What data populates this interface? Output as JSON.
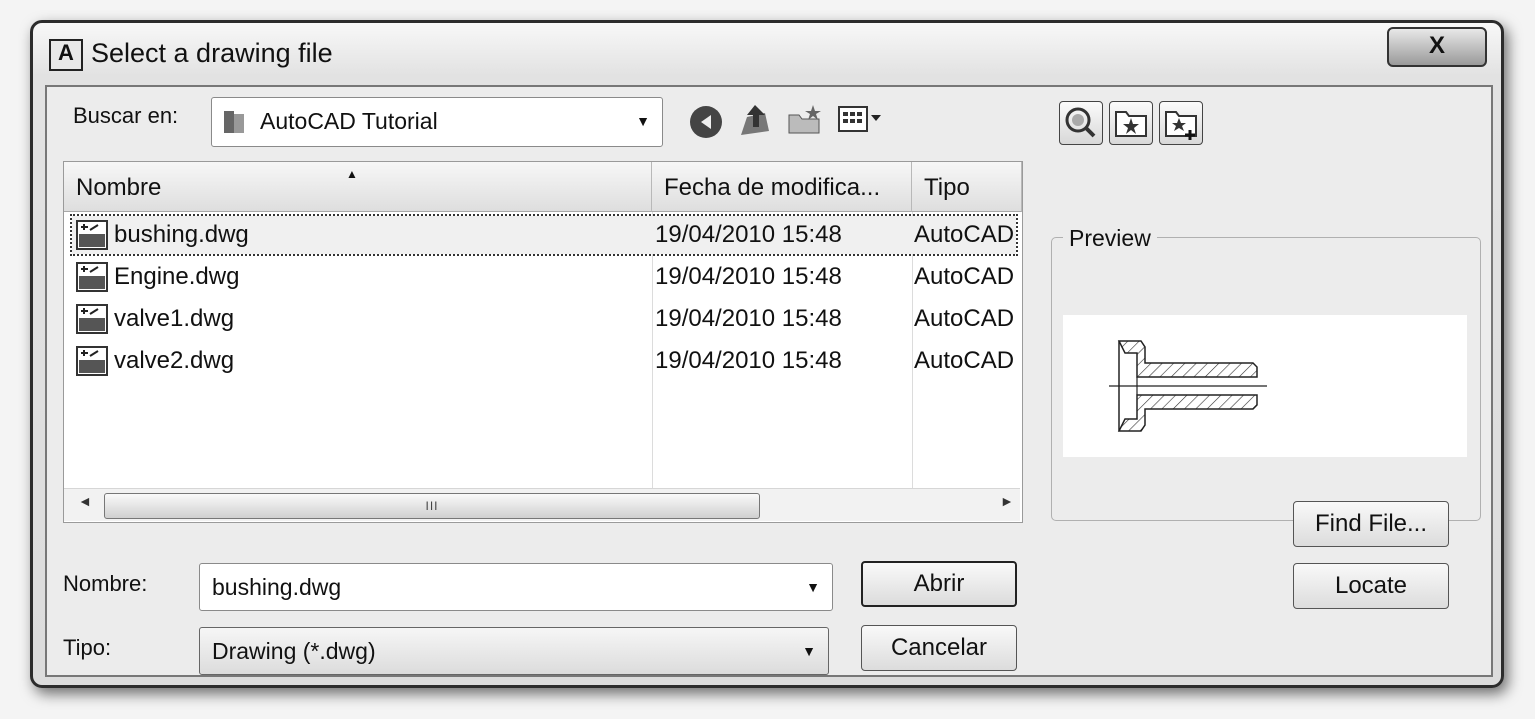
{
  "window": {
    "title": "Select a drawing file",
    "app_icon_letter": "A",
    "close_label": "X"
  },
  "look_in": {
    "label": "Buscar en:",
    "value": "AutoCAD Tutorial"
  },
  "toolbar": {
    "icons": [
      "back-icon",
      "up-folder-icon",
      "new-folder-icon",
      "views-menu-icon"
    ]
  },
  "right_toolbar": {
    "icons": [
      "search-web-icon",
      "favorites-icon",
      "add-to-favorites-icon"
    ]
  },
  "file_list": {
    "columns": [
      "Nombre",
      "Fecha de modifica...",
      "Tipo"
    ],
    "rows": [
      {
        "name": "bushing.dwg",
        "date": "19/04/2010 15:48",
        "type": "AutoCAD"
      },
      {
        "name": "Engine.dwg",
        "date": "19/04/2010 15:48",
        "type": "AutoCAD"
      },
      {
        "name": "valve1.dwg",
        "date": "19/04/2010 15:48",
        "type": "AutoCAD"
      },
      {
        "name": "valve2.dwg",
        "date": "19/04/2010 15:48",
        "type": "AutoCAD"
      }
    ],
    "selected_index": 0,
    "scroll_thumb_grip": "III"
  },
  "filename": {
    "label": "Nombre:",
    "value": "bushing.dwg"
  },
  "filetype": {
    "label": "Tipo:",
    "value": "Drawing (*.dwg)"
  },
  "buttons": {
    "open": "Abrir",
    "cancel": "Cancelar",
    "find_file": "Find File...",
    "locate": "Locate"
  },
  "preview": {
    "label": "Preview"
  }
}
